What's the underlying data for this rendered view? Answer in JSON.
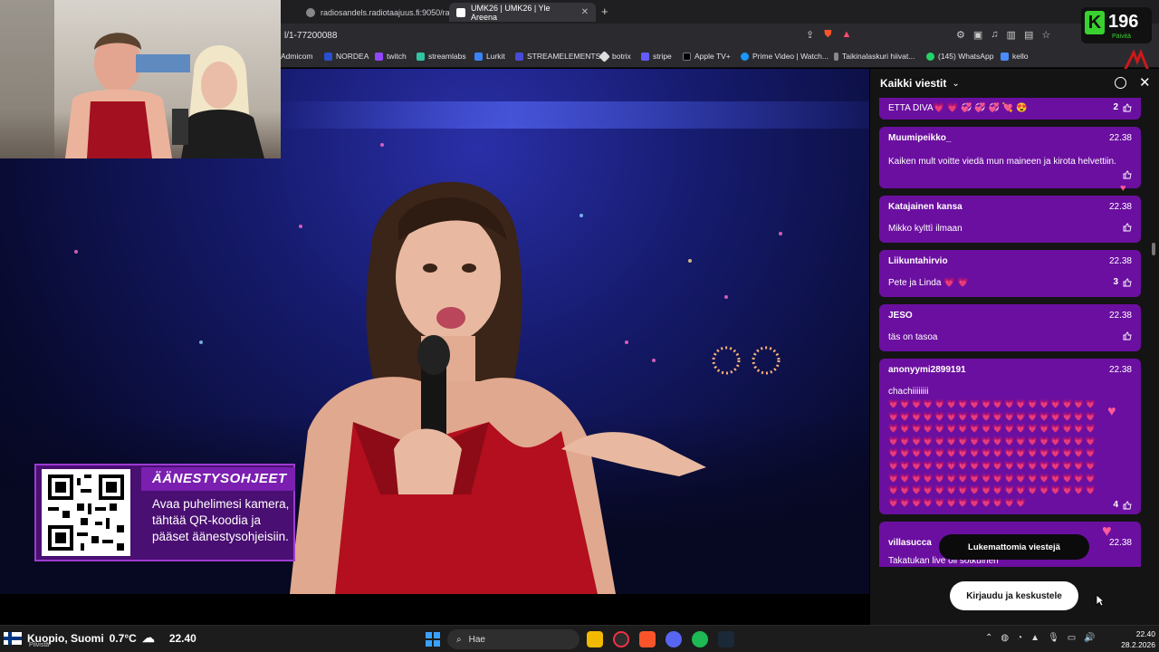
{
  "browser": {
    "tabs": [
      {
        "label": "radiosandels.radiotaajuus.fi:9050/radi",
        "active": false
      },
      {
        "label": "UMK26 | UMK26 | Yle Areena",
        "active": true
      }
    ],
    "url": "l/1-77200088",
    "bookmarks": [
      "Admicom",
      "NORDEA",
      "twitch",
      "streamlabs",
      "Lurkit",
      "STREAMELEMENTS",
      "botrix",
      "stripe",
      "Apple TV+",
      "Prime Video | Watch...",
      "Taikinalaskuri hiivat...",
      "(145) WhatsApp",
      "kello"
    ]
  },
  "kick_badge": {
    "count": "196",
    "label": "Päivitä"
  },
  "overlay": {
    "title": "ÄÄNESTYSOHJEET",
    "text": "Avaa puhelimesi kamera, tähtää QR-koodia ja pääset äänestysohjeisiin."
  },
  "chat": {
    "title": "Kaikki viestit",
    "messages": [
      {
        "user": "",
        "time": "",
        "text": "ETTA DIVA💗 💗 💞 💞 💞 💘 😍",
        "likes": "2"
      },
      {
        "user": "Muumipeikko_",
        "time": "22.38",
        "text": "Kaiken mult voitte viedä mun maineen ja kirota helvettiin.",
        "likes": ""
      },
      {
        "user": "Katajainen kansa",
        "time": "22.38",
        "text": "Mikko kylttì ilmaan",
        "likes": ""
      },
      {
        "user": "Liikuntahirvio",
        "time": "22.38",
        "text": "Pete ja Linda 💗 💗",
        "likes": "3"
      },
      {
        "user": "JESO",
        "time": "22.38",
        "text": "täs on tasoa",
        "likes": ""
      },
      {
        "user": "anonyymi2899191",
        "time": "22.38",
        "text": "chachiiiiiiii",
        "likes": "4"
      },
      {
        "user": "villasucca",
        "time": "22.38",
        "text": "Takatukan live oli sotkuinen",
        "likes": ""
      }
    ],
    "hearts": "💗💗💗💗💗💗💗💗💗💗💗💗💗💗💗💗💗💗💗💗💗💗💗💗💗💗💗💗💗💗💗💗💗💗💗💗💗💗💗💗💗💗💗💗💗💗💗💗💗💗💗💗💗💗💗💗💗💗💗💗💗💗💗💗💗💗💗💗💗💗💗💗💗💗💗💗💗💗💗💗💗💗💗💗💗💗💗💗💗💗💗💗💗💗💗💗💗💗💗💗💗💗💗💗💗💗💗💗💗💗💗💗💗💗💗💗💗💗💗💗💗💗💗💗💗💗💗💗💗💗💗💗💗💗💗💗💗💗💗💗💗💗💗💗💗💗💗💗💗💗💗💗💗💗💗💗",
    "unread_label": "Lukemattomia viestejä",
    "login_label": "Kirjaudu ja keskustele"
  },
  "taskbar": {
    "location": "Kuopio, Suomi",
    "temperature": "0.7°C",
    "weather_sub": "Pilvistä",
    "time_left": "22.40",
    "search_placeholder": "Hae",
    "clock_time": "22.40",
    "clock_date": "28.2.2026"
  },
  "colors": {
    "chat_bubble": "#6b0fa0",
    "overlay_purple": "#7a1fb0",
    "kick_green": "#39d12f"
  }
}
